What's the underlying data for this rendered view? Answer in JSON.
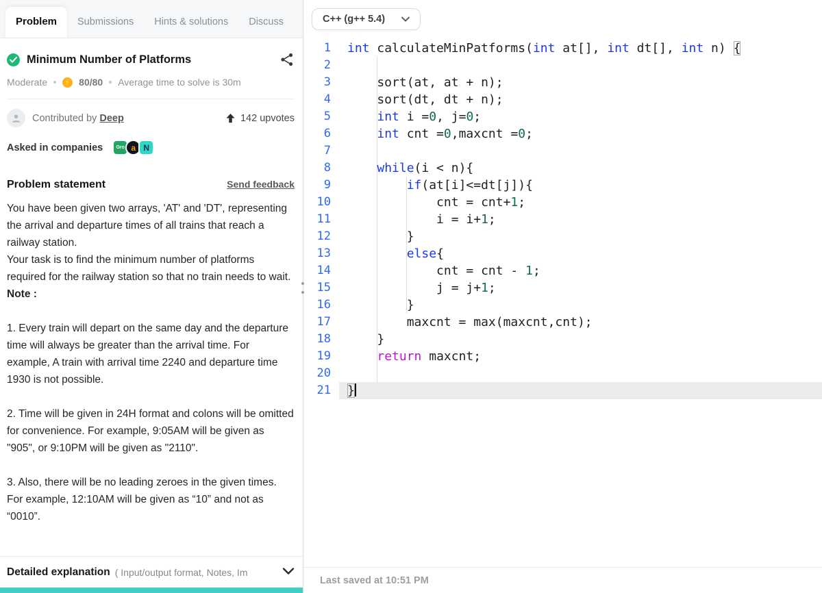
{
  "colors": {
    "accent_teal": "#41cfc5",
    "gutter_blue": "#2e68f6",
    "keyword_blue": "#1c39e8",
    "return_magenta": "#b818c8",
    "number_green": "#116b4b",
    "active_line_bg": "#ececec",
    "success_green": "#1fb87a",
    "coin_orange": "#ffaf1b"
  },
  "tabs": [
    {
      "label": "Problem",
      "active": true
    },
    {
      "label": "Submissions",
      "active": false
    },
    {
      "label": "Hints & solutions",
      "active": false
    },
    {
      "label": "Discuss",
      "active": false
    }
  ],
  "problem": {
    "title": "Minimum Number of Platforms",
    "difficulty": "Moderate",
    "score": "80/80",
    "avg_time": "Average time to solve is 30m",
    "contributed_prefix": "Contributed by",
    "contributor": "Deep",
    "upvotes": "142 upvotes",
    "asked_in_label": "Asked in companies",
    "companies": [
      {
        "label": "Gro",
        "bg": "#23a566",
        "fg": "#ffffff",
        "shape": "square"
      },
      {
        "label": "a",
        "bg": "#10161e",
        "fg": "#ff9900",
        "shape": "circle"
      },
      {
        "label": "N",
        "bg": "#2fd7c4",
        "fg": "#14325c",
        "shape": "square"
      }
    ],
    "statement_heading": "Problem statement",
    "send_feedback": "Send feedback",
    "paragraphs": [
      {
        "text": "You have been given two arrays, 'AT' and 'DT', representing the arrival and departure times of all trains that reach a railway station.",
        "bold": false,
        "gap": false
      },
      {
        "text": "Your task is to find the minimum number of platforms required for the railway station so that no train needs to wait.",
        "bold": false,
        "gap": false
      },
      {
        "text": "Note :",
        "bold": true,
        "gap": false
      },
      {
        "text": "1. Every train will depart on the same day and the departure time will always be greater than the arrival time. For example, A train with arrival time 2240 and departure time 1930 is not possible.",
        "bold": false,
        "gap": true
      },
      {
        "text": "2. Time will be given in 24H format and colons will be omitted for convenience. For example, 9:05AM will be given as \"905\", or 9:10PM will be given as \"2110\".",
        "bold": false,
        "gap": true
      },
      {
        "text": "3. Also, there will be no leading zeroes in the given times. For example, 12:10AM will be given as “10” and not as “0010”.",
        "bold": false,
        "gap": true
      }
    ],
    "detailed_explanation": "Detailed explanation",
    "detailed_explanation_sub": "( Input/output format, Notes, Im"
  },
  "editor": {
    "language": "C++ (g++ 5.4)",
    "last_saved": "Last saved at 10:51 PM",
    "active_line": 21,
    "lines": [
      [
        [
          "k",
          "int"
        ],
        [
          "p",
          " calculateMinPatforms("
        ],
        [
          "k",
          "int"
        ],
        [
          "p",
          " at[], "
        ],
        [
          "k",
          "int"
        ],
        [
          "p",
          " dt[], "
        ],
        [
          "k",
          "int"
        ],
        [
          "p",
          " n) "
        ],
        [
          "m",
          "{"
        ]
      ],
      [],
      [
        [
          "p",
          "    sort(at, at + n);"
        ]
      ],
      [
        [
          "p",
          "    sort(dt, dt + n);"
        ]
      ],
      [
        [
          "p",
          "    "
        ],
        [
          "k",
          "int"
        ],
        [
          "p",
          " i ="
        ],
        [
          "n",
          "0"
        ],
        [
          "p",
          ", j="
        ],
        [
          "n",
          "0"
        ],
        [
          "p",
          ";"
        ]
      ],
      [
        [
          "p",
          "    "
        ],
        [
          "k",
          "int"
        ],
        [
          "p",
          " cnt ="
        ],
        [
          "n",
          "0"
        ],
        [
          "p",
          ",maxcnt ="
        ],
        [
          "n",
          "0"
        ],
        [
          "p",
          ";"
        ]
      ],
      [],
      [
        [
          "p",
          "    "
        ],
        [
          "k",
          "while"
        ],
        [
          "p",
          "(i < n){"
        ]
      ],
      [
        [
          "p",
          "        "
        ],
        [
          "k",
          "if"
        ],
        [
          "p",
          "(at[i]<=dt[j]){"
        ]
      ],
      [
        [
          "p",
          "            cnt = cnt+"
        ],
        [
          "n",
          "1"
        ],
        [
          "p",
          ";"
        ]
      ],
      [
        [
          "p",
          "            i = i+"
        ],
        [
          "n",
          "1"
        ],
        [
          "p",
          ";"
        ]
      ],
      [
        [
          "p",
          "        }"
        ]
      ],
      [
        [
          "p",
          "        "
        ],
        [
          "k",
          "else"
        ],
        [
          "p",
          "{"
        ]
      ],
      [
        [
          "p",
          "            cnt = cnt - "
        ],
        [
          "n",
          "1"
        ],
        [
          "p",
          ";"
        ]
      ],
      [
        [
          "p",
          "            j = j+"
        ],
        [
          "n",
          "1"
        ],
        [
          "p",
          ";"
        ]
      ],
      [
        [
          "p",
          "        }"
        ]
      ],
      [
        [
          "p",
          "        maxcnt = max(maxcnt,cnt);"
        ]
      ],
      [
        [
          "p",
          "    }"
        ]
      ],
      [
        [
          "p",
          "    "
        ],
        [
          "r",
          "return"
        ],
        [
          "p",
          " maxcnt;"
        ]
      ],
      [],
      [
        [
          "m",
          "}"
        ]
      ]
    ]
  }
}
